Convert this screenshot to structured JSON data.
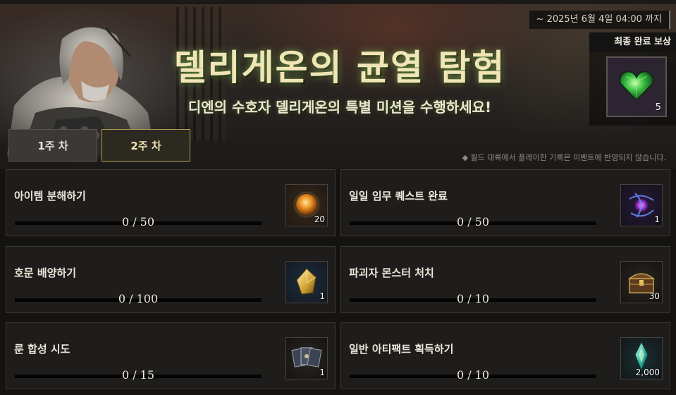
{
  "period": "~ 2025년 6월 4일 04:00 까지",
  "title": "델리게온의 균열 탐험",
  "subtitle": "디엔의 수호자 델리게온의 특별 미션을 수행하세요!",
  "final_reward": {
    "label": "최종 완료 보상",
    "icon": "green-heart-gem-icon",
    "count": "5"
  },
  "tabs": [
    {
      "label": "1주 차",
      "selected": false
    },
    {
      "label": "2주 차",
      "selected": true
    }
  ],
  "notice": "◆ 월드 대륙에서 플레이한 기록은 이벤트에 반영되지 않습니다.",
  "missions": [
    {
      "title": "아이템 분해하기",
      "current": 0,
      "total": 50,
      "progress_text": "0 / 50",
      "reward_icon": "orange-orb-icon",
      "reward_count": "20"
    },
    {
      "title": "일일 임무 퀘스트 완료",
      "current": 0,
      "total": 50,
      "progress_text": "0 / 50",
      "reward_icon": "purple-energy-orb-icon",
      "reward_count": "1"
    },
    {
      "title": "호문 배양하기",
      "current": 0,
      "total": 100,
      "progress_text": "0 / 100",
      "reward_icon": "gold-crystal-icon",
      "reward_count": "1"
    },
    {
      "title": "파괴자 몬스터 처치",
      "current": 0,
      "total": 10,
      "progress_text": "0 / 10",
      "reward_icon": "treasure-chest-icon",
      "reward_count": "30"
    },
    {
      "title": "룬 합성 시도",
      "current": 0,
      "total": 15,
      "progress_text": "0 / 15",
      "reward_icon": "rune-cards-icon",
      "reward_count": "1"
    },
    {
      "title": "일반 아티팩트 획득하기",
      "current": 0,
      "total": 10,
      "progress_text": "0 / 10",
      "reward_icon": "blue-crystal-icon",
      "reward_count": "2,000"
    }
  ]
}
